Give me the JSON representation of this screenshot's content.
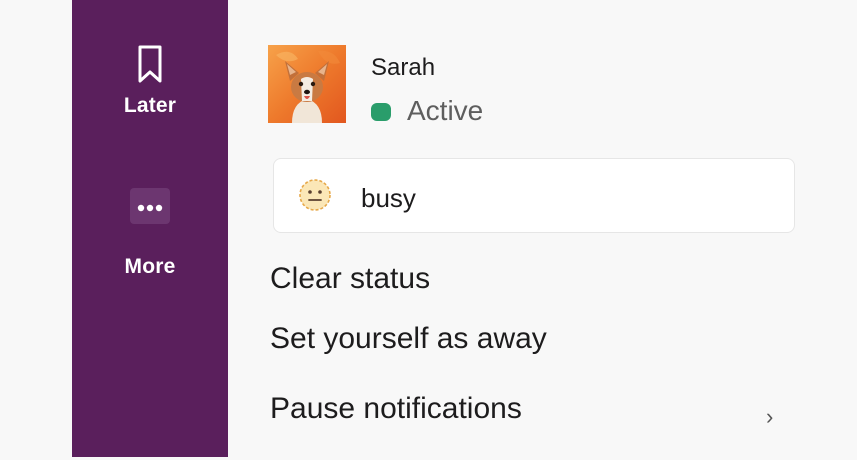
{
  "sidebar": {
    "later": {
      "label": "Later",
      "icon": "bookmark-icon"
    },
    "more": {
      "label": "More",
      "icon": "more-horizontal-icon"
    }
  },
  "profile": {
    "name": "Sarah",
    "presence": "Active",
    "presence_color": "#2a9d6b",
    "avatar_alt": "corgi-photo"
  },
  "status": {
    "emoji": "neutral-face-icon",
    "text": "busy"
  },
  "menu": {
    "clear_status": "Clear status",
    "set_away": "Set yourself as away",
    "pause_notifications": "Pause notifications"
  },
  "colors": {
    "sidebar_bg": "#5a1f5c",
    "page_bg": "#f8f8f8",
    "text_primary": "#1d1c1d"
  }
}
